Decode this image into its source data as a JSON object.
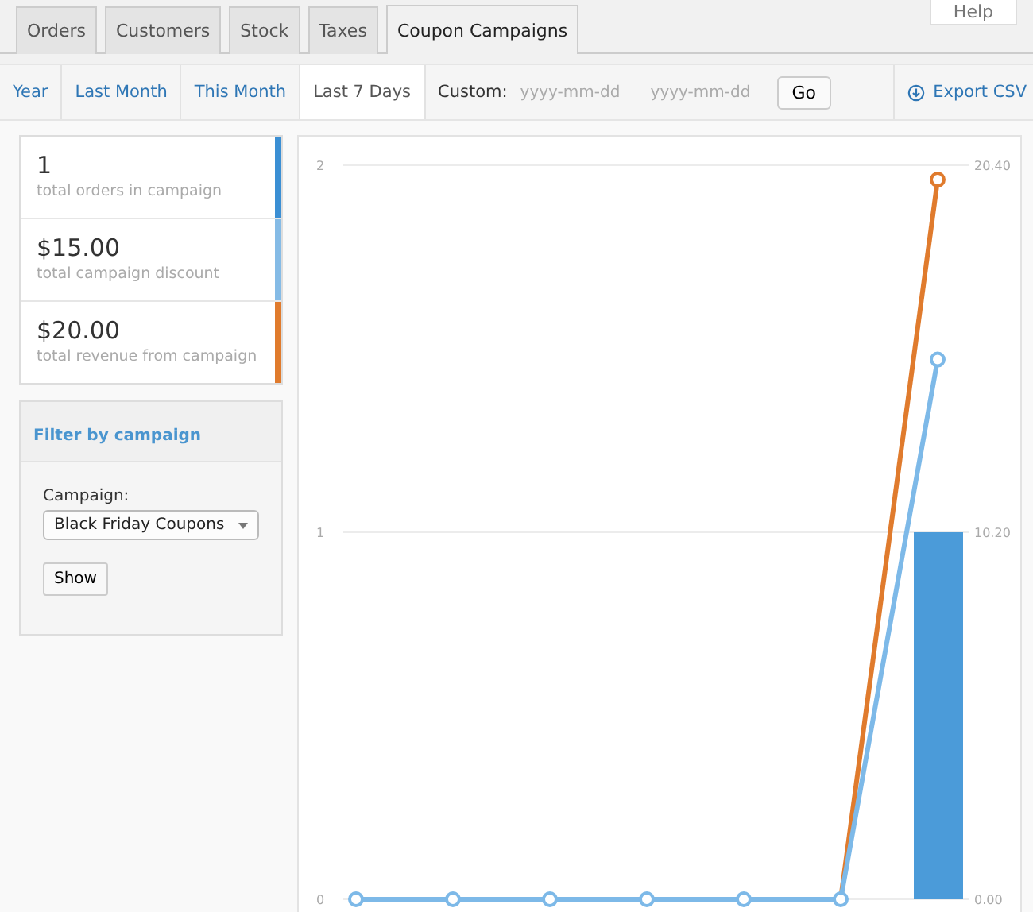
{
  "help_button": {
    "label": "Help"
  },
  "tabs": [
    {
      "label": "Orders",
      "selected": false
    },
    {
      "label": "Customers",
      "selected": false
    },
    {
      "label": "Stock",
      "selected": false
    },
    {
      "label": "Taxes",
      "selected": false
    },
    {
      "label": "Coupon Campaigns",
      "selected": true
    }
  ],
  "ranges": [
    {
      "label": "Year",
      "selected": false
    },
    {
      "label": "Last Month",
      "selected": false
    },
    {
      "label": "This Month",
      "selected": false
    },
    {
      "label": "Last 7 Days",
      "selected": true
    }
  ],
  "custom": {
    "label": "Custom:",
    "from": {
      "placeholder": "yyyy-mm-dd"
    },
    "to": {
      "placeholder": "yyyy-mm-dd"
    },
    "button": "Go"
  },
  "export": {
    "label": "Export CSV"
  },
  "stats": [
    {
      "value": "1",
      "label": "total orders in campaign",
      "color": "#3b8fd4"
    },
    {
      "value": "$15.00",
      "label": "total campaign discount",
      "color": "#85bbe6"
    },
    {
      "value": "$20.00",
      "label": "total revenue from campaign",
      "color": "#e07b2d"
    }
  ],
  "filter": {
    "title": "Filter by campaign",
    "field_label": "Campaign:",
    "selected_value": "Black Friday Coupons",
    "button": "Show"
  },
  "chart": {
    "chart_data": {
      "type": "bar",
      "ylim": [
        0,
        2
      ],
      "y2lim": [
        0,
        20.4
      ],
      "yticks": [
        0,
        1,
        2
      ],
      "y2ticks": [
        {
          "value": 0,
          "label": "0.00"
        },
        {
          "value": 10.2,
          "label": "10.20"
        },
        {
          "value": 20.4,
          "label": "20.40"
        }
      ],
      "series": [
        {
          "color": "#4b9bd9",
          "values": [
            0,
            0,
            0,
            0,
            0,
            0,
            1
          ]
        },
        {
          "type": "line",
          "axis": "y2",
          "marker": "circle",
          "color": "#7db9e8",
          "values": [
            0,
            0,
            0,
            0,
            0,
            0,
            15
          ]
        },
        {
          "type": "line",
          "axis": "y2",
          "marker": "circle",
          "color": "#e07b2d",
          "values": [
            null,
            null,
            null,
            null,
            null,
            0,
            20
          ]
        }
      ]
    }
  }
}
